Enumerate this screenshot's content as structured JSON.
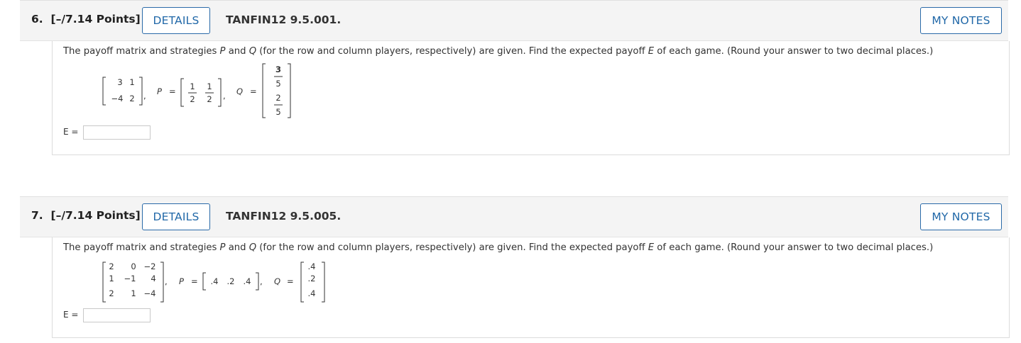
{
  "questions": [
    {
      "number": "6.",
      "points": "[–/7.14 Points]",
      "details_label": "DETAILS",
      "code": "TANFIN12 9.5.001.",
      "notes_label": "MY NOTES",
      "prompt_a": "The payoff matrix and strategies ",
      "var_p": "P",
      "prompt_b": " and ",
      "var_q": "Q",
      "prompt_c": " (for the row and column players, respectively) are given. Find the expected payoff ",
      "var_e": "E",
      "prompt_d": " of each game. (Round your answer to two decimal places.)",
      "matrix": [
        [
          "3",
          "1"
        ],
        [
          "−4",
          "2"
        ]
      ],
      "p_label": "P",
      "q_label": "Q",
      "eq": "=",
      "comma": ",",
      "p_values": [
        {
          "num": "1",
          "den": "2"
        },
        {
          "num": "1",
          "den": "2"
        }
      ],
      "q_values": [
        {
          "num": "3",
          "den": "5"
        },
        {
          "num": "2",
          "den": "5"
        }
      ],
      "e_label": "E",
      "answer_value": ""
    },
    {
      "number": "7.",
      "points": "[–/7.14 Points]",
      "details_label": "DETAILS",
      "code": "TANFIN12 9.5.005.",
      "notes_label": "MY NOTES",
      "prompt_a": "The payoff matrix and strategies ",
      "var_p": "P",
      "prompt_b": " and ",
      "var_q": "Q",
      "prompt_c": " (for the row and column players, respectively) are given. Find the expected payoff ",
      "var_e": "E",
      "prompt_d": " of each game. (Round your answer to two decimal places.)",
      "matrix": [
        [
          "2",
          "0",
          "−2"
        ],
        [
          "1",
          "−1",
          "4"
        ],
        [
          "2",
          "1",
          "−4"
        ]
      ],
      "p_label": "P",
      "q_label": "Q",
      "eq": "=",
      "comma": ",",
      "p_values": [
        ".4",
        ".2",
        ".4"
      ],
      "q_values": [
        ".4",
        ".2",
        ".4"
      ],
      "e_label": "E",
      "answer_value": ""
    }
  ]
}
